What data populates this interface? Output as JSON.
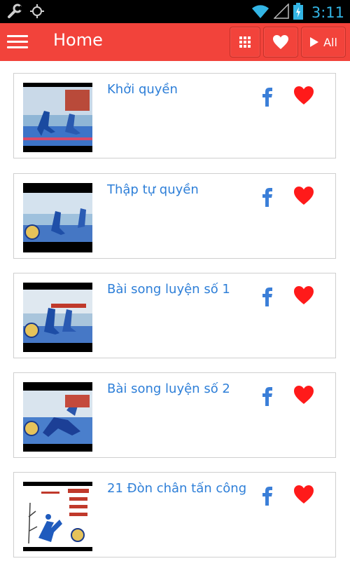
{
  "statusbar": {
    "time": "3:11"
  },
  "appbar": {
    "title": "Home",
    "all_label": "All"
  },
  "colors": {
    "appbar": "#f2433b",
    "title_blue": "#2e7fd8",
    "heart_red": "#ff1a1a",
    "facebook_blue": "#3b7fd8"
  },
  "items": [
    {
      "title": "Khởi quyền"
    },
    {
      "title": "Thập tự quyền"
    },
    {
      "title": "Bài song luyện số 1"
    },
    {
      "title": "Bài song luyện số 2"
    },
    {
      "title": "21 Đòn chân tấn công"
    }
  ]
}
